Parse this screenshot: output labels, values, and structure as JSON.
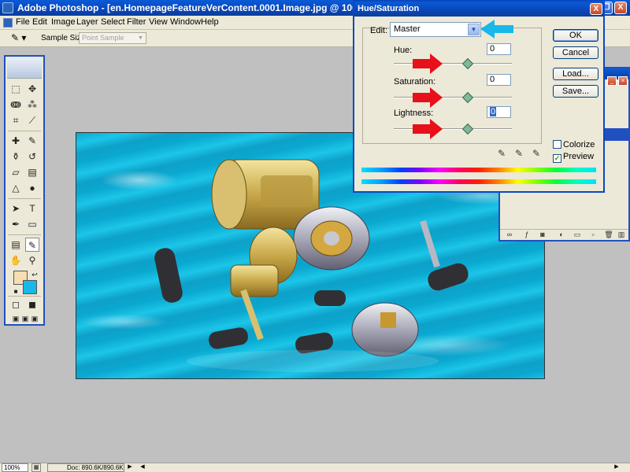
{
  "window": {
    "title": "Adobe Photoshop - [en.HomepageFeatureVerContent.0001.Image.jpg @ 100% (RGB/8)]",
    "minimize": "_",
    "restore": "❐",
    "close": "X"
  },
  "menu": [
    "File",
    "Edit",
    "Image",
    "Layer",
    "Select",
    "Filter",
    "View",
    "Window",
    "Help"
  ],
  "options": {
    "sample_size_label": "Sample Size:",
    "sample_size_value": "Point Sample"
  },
  "dialog": {
    "title": "Hue/Saturation",
    "close": "X",
    "edit_label": "Edit:",
    "edit_value": "Master",
    "hue_label": "Hue:",
    "hue_value": "0",
    "saturation_label": "Saturation:",
    "saturation_value": "0",
    "lightness_label": "Lightness:",
    "lightness_value": "0",
    "ok": "OK",
    "cancel": "Cancel",
    "load": "Load...",
    "save": "Save...",
    "colorize_label": "Colorize",
    "colorize_checked": false,
    "preview_label": "Preview",
    "preview_checked": true,
    "hue_level": 0.5,
    "saturation_level": 0.5,
    "lightness_level": 0.5
  },
  "status": {
    "zoom": "100%",
    "doc": "Doc: 890.6K/890.6K"
  },
  "colors": {
    "foreground": "#f7deb0",
    "background": "#18b8ea",
    "annotation_red": "#e8101a",
    "annotation_blue": "#18b8ea"
  }
}
